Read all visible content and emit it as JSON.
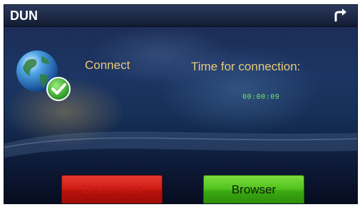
{
  "window": {
    "title": "DUN"
  },
  "status": {
    "label": "Connect"
  },
  "connection": {
    "time_label": "Time for connection:",
    "elapsed": "00:00:09"
  },
  "buttons": {
    "disconnect": "Disconnect",
    "browser": "Browser"
  },
  "icons": {
    "back": "return-arrow-icon",
    "status": "globe-check-icon"
  },
  "colors": {
    "label": "#e8c977",
    "timer": "#6fe26a",
    "disconnect": "#d11e16",
    "browser": "#53c51e"
  }
}
